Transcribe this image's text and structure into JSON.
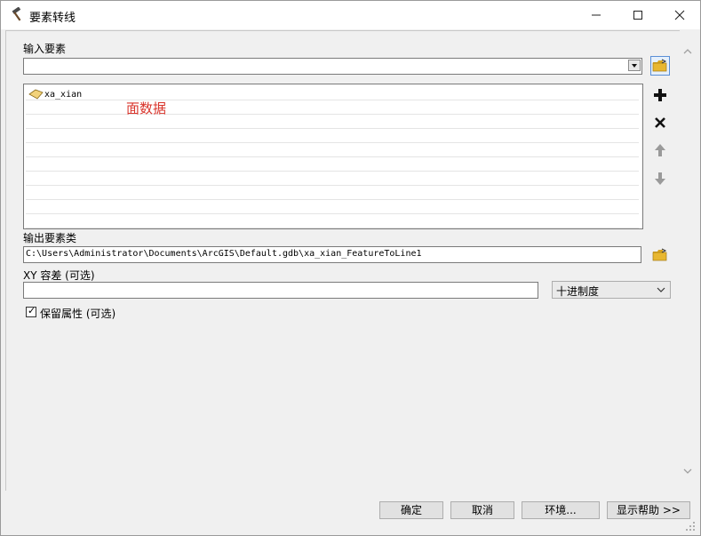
{
  "window": {
    "title": "要素转线",
    "icon": "hammer-icon"
  },
  "input_features": {
    "label": "输入要素",
    "value": "",
    "items": [
      {
        "name": "xa_xian",
        "icon": "polygon-layer-icon"
      }
    ],
    "annotation": "面数据",
    "annotation_color": "#d9342b"
  },
  "side_buttons": [
    "open-folder-icon",
    "add-icon",
    "remove-icon",
    "move-up-icon",
    "move-down-icon"
  ],
  "output": {
    "label": "输出要素类",
    "value": "C:\\Users\\Administrator\\Documents\\ArcGIS\\Default.gdb\\xa_xian_FeatureToLine1"
  },
  "tolerance": {
    "label": "XY 容差 (可选)",
    "value": "",
    "unit": "十进制度"
  },
  "preserve": {
    "label": "保留属性 (可选)",
    "checked": true
  },
  "buttons": {
    "ok": "确定",
    "cancel": "取消",
    "env": "环境...",
    "help": "显示帮助 >>"
  },
  "colors": {
    "accent_border": "#5a8fd6",
    "folder": "#e8b730"
  }
}
